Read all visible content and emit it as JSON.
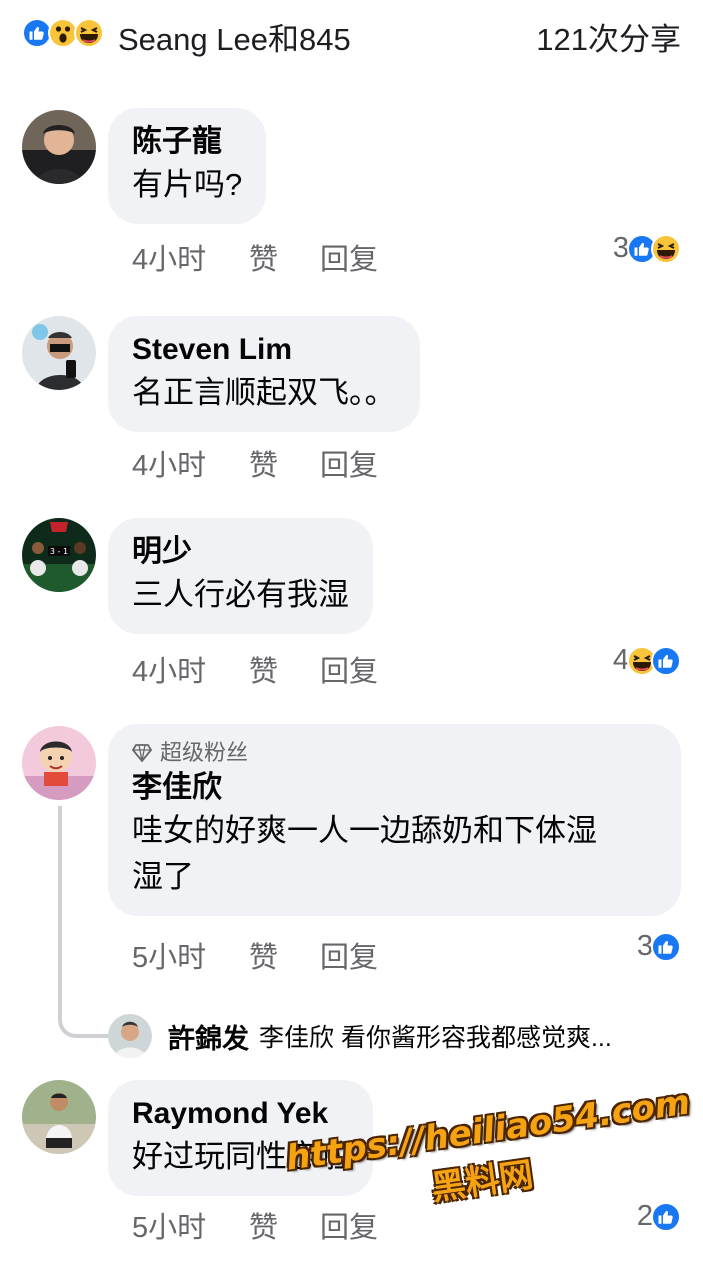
{
  "header": {
    "reaction_icons": [
      "like-icon",
      "wow-icon",
      "haha-icon"
    ],
    "names": "Seang Lee和845",
    "shares": "121次分享"
  },
  "colors": {
    "like": "#1877f2",
    "emoji": "#f7c43a",
    "bubble": "#f0f2f5",
    "meta": "#65676b"
  },
  "comments": [
    {
      "name": "陈子龍",
      "text": "有片吗?",
      "time": "4小时",
      "like": "赞",
      "reply": "回复",
      "reaction_count": "3",
      "reactions": [
        "like-icon",
        "haha-icon"
      ]
    },
    {
      "name": "Steven Lim",
      "text": "名正言顺起双飞。。",
      "time": "4小时",
      "like": "赞",
      "reply": "回复",
      "reaction_count": "",
      "reactions": []
    },
    {
      "name": "明少",
      "text": "三人行必有我湿",
      "time": "4小时",
      "like": "赞",
      "reply": "回复",
      "reaction_count": "4",
      "reactions": [
        "haha-icon",
        "like-icon"
      ]
    },
    {
      "badge": "超级粉丝",
      "name": "李佳欣",
      "text_line1": "哇女的好爽一人一边舔奶和下体湿",
      "text_line2": "湿了",
      "time": "5小时",
      "like": "赞",
      "reply": "回复",
      "reaction_count": "3",
      "reactions": [
        "like-icon"
      ]
    },
    {
      "name": "Raymond Yek",
      "text": "好过玩同性恋啦",
      "time": "5小时",
      "like": "赞",
      "reply": "回复",
      "reaction_count": "2",
      "reactions": [
        "like-icon"
      ]
    }
  ],
  "reply_preview": {
    "name": "許錦发",
    "text": "李佳欣 看你酱形容我都感觉爽..."
  },
  "watermark": {
    "url": "https://heiliao54.com",
    "label": "黑料网"
  }
}
